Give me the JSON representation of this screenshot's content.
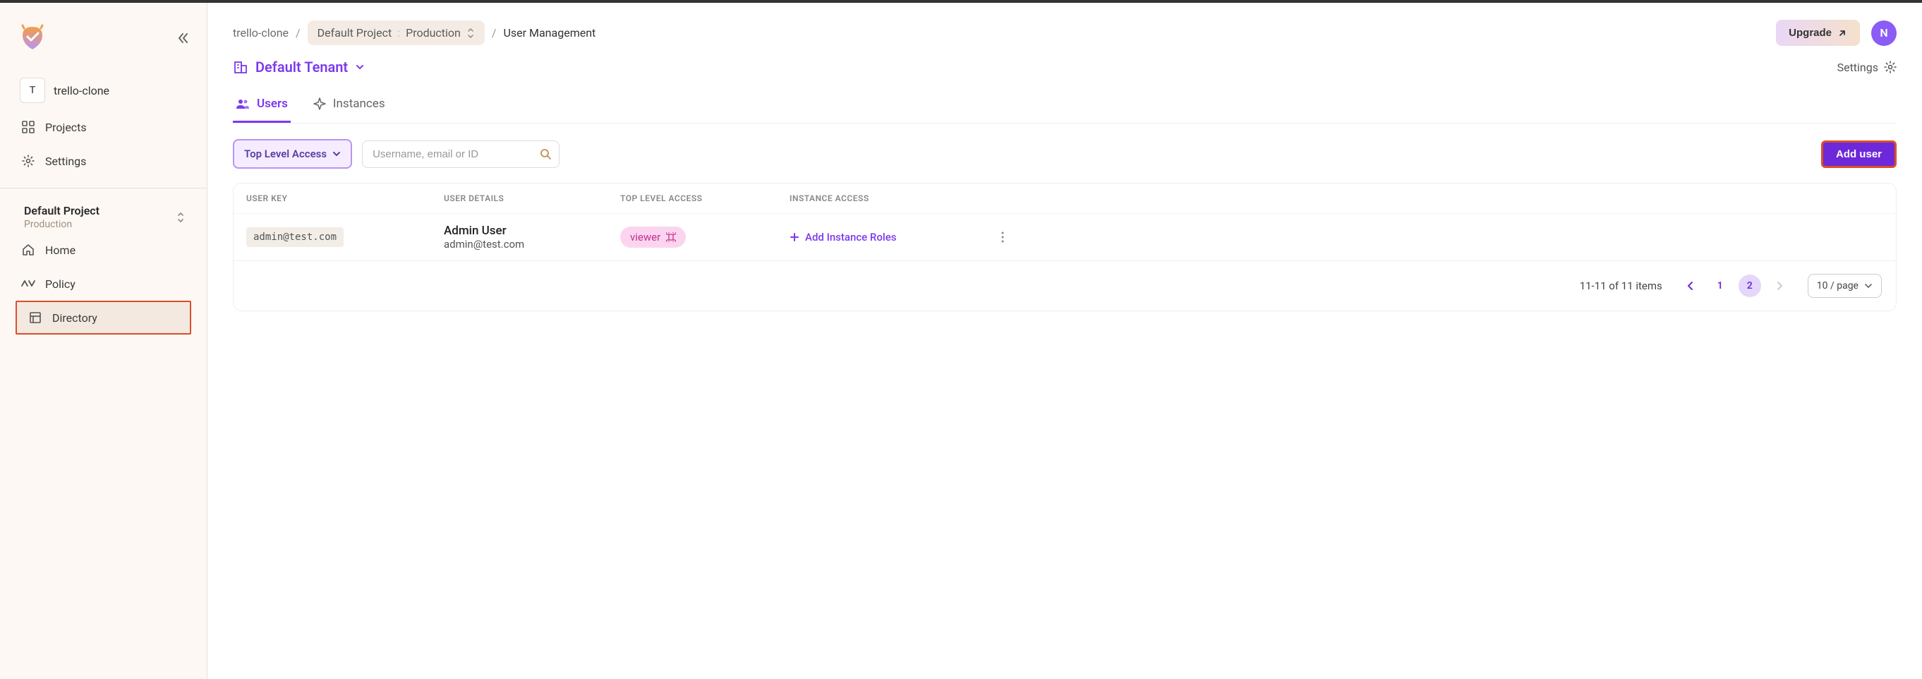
{
  "workspace": {
    "badge": "T",
    "name": "trello-clone"
  },
  "sidebar": {
    "projects": "Projects",
    "settings": "Settings",
    "project_name": "Default Project",
    "project_env": "Production",
    "home": "Home",
    "policy": "Policy",
    "directory": "Directory"
  },
  "breadcrumb": {
    "workspace": "trello-clone",
    "project": "Default Project",
    "env": "Production",
    "page": "User Management"
  },
  "topbar": {
    "upgrade": "Upgrade",
    "avatar_initial": "N"
  },
  "tenant": {
    "name": "Default Tenant",
    "settings": "Settings"
  },
  "tabs": {
    "users": "Users",
    "instances": "Instances"
  },
  "filters": {
    "access": "Top Level Access",
    "search_placeholder": "Username, email or ID",
    "add_user": "Add user"
  },
  "table": {
    "headers": {
      "user_key": "USER KEY",
      "user_details": "USER DETAILS",
      "top_level_access": "TOP LEVEL ACCESS",
      "instance_access": "INSTANCE ACCESS"
    },
    "rows": [
      {
        "key": "admin@test.com",
        "name": "Admin User",
        "email": "admin@test.com",
        "role": "viewer",
        "add_roles": "Add Instance Roles"
      }
    ]
  },
  "pagination": {
    "info": "11-11 of 11 items",
    "pages": [
      "1",
      "2"
    ],
    "current": "2",
    "page_size": "10 / page"
  }
}
